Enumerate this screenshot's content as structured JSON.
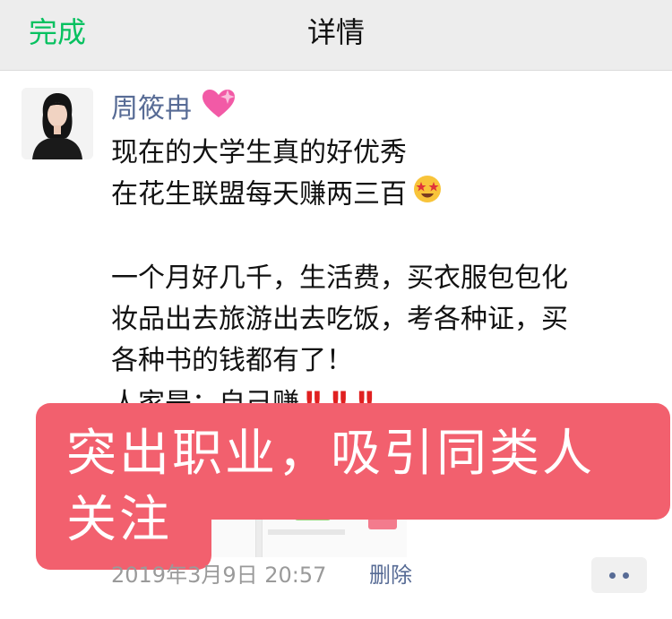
{
  "navbar": {
    "done_label": "完成",
    "title": "详情"
  },
  "post": {
    "author": "周筱冉",
    "content_lines": [
      "现在的大学生真的好优秀",
      "在花生联盟每天赚两三百",
      "一个月好几千，生活费，买衣服包包化",
      "妆品出去旅游出去吃饭，考各种证，买",
      "各种书的钱都有了！",
      "人家是：自己赚"
    ],
    "timestamp": "2019年3月9日 20:57",
    "delete_label": "删除"
  },
  "overlay": {
    "line1": "突出职业，吸引同类人",
    "line2": "关注"
  },
  "icons": {
    "heart": "sparkling-heart-icon",
    "emoji": "star-struck-emoji-icon",
    "bang": "double-exclamation-icon",
    "more": "more-dots-icon"
  },
  "colors": {
    "nav_done": "#07c160",
    "link": "#576b95",
    "overlay": "#f2606e",
    "bang": "#e02020"
  }
}
